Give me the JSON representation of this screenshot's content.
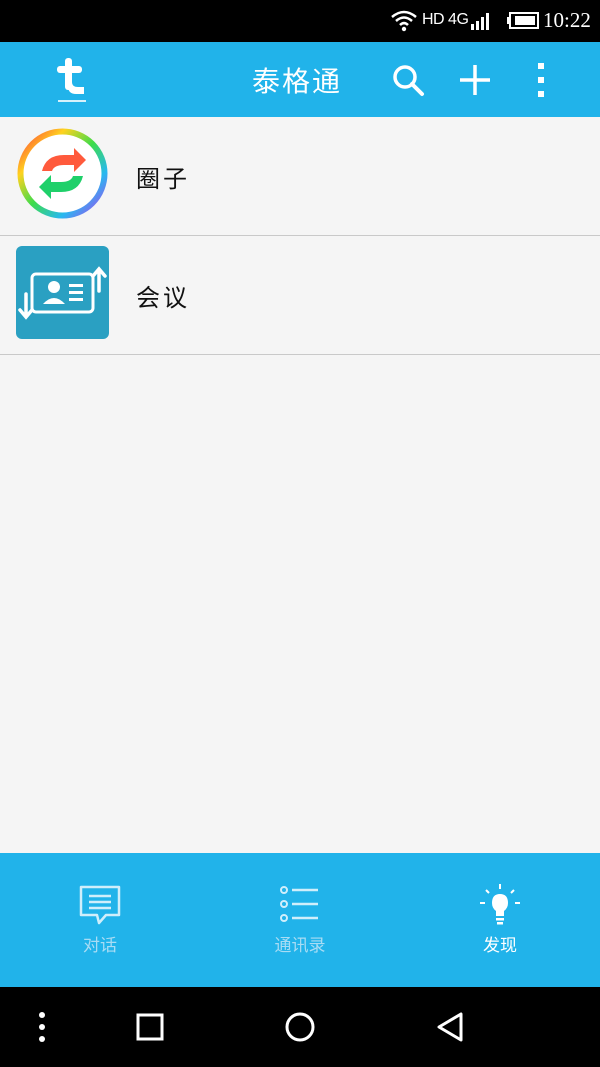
{
  "status_bar": {
    "network": "HD 4G",
    "time": "10:22"
  },
  "app_bar": {
    "title": "泰格通",
    "logo_icon": "t-logo-icon",
    "actions": [
      "search-icon",
      "plus-icon",
      "more-vert-icon"
    ]
  },
  "list": {
    "items": [
      {
        "label": "圈子",
        "icon": "circle-sync-icon"
      },
      {
        "label": "会议",
        "icon": "meeting-card-icon"
      }
    ]
  },
  "bottom_nav": {
    "tabs": [
      {
        "label": "对话",
        "icon": "chat-bubble-icon",
        "active": false
      },
      {
        "label": "通讯录",
        "icon": "contact-list-icon",
        "active": false
      },
      {
        "label": "发现",
        "icon": "lightbulb-icon",
        "active": true
      }
    ]
  },
  "colors": {
    "primary": "#21b3ea",
    "background": "#f5f5f5",
    "divider": "#c9c9c9",
    "meeting_icon_bg": "#2aa0c2",
    "inactive_tab": "#a8dcf4",
    "active_tab": "#ffffff"
  },
  "system_nav": {
    "buttons": [
      "menu-dots-icon",
      "recents-square-icon",
      "home-circle-icon",
      "back-triangle-icon"
    ]
  }
}
